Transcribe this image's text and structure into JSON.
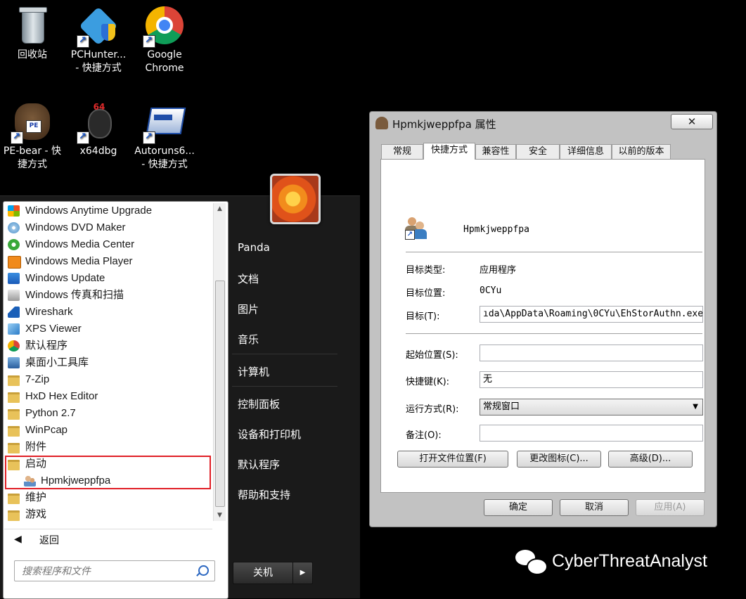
{
  "desktop": {
    "icons": [
      {
        "label": "回收站"
      },
      {
        "label": "PCHunter...",
        "label2": "- 快捷方式"
      },
      {
        "label": "Google",
        "label2": "Chrome"
      },
      {
        "label": "PE-bear - 快",
        "label2": "捷方式",
        "badge": "PE"
      },
      {
        "label": "x64dbg",
        "badge": "64"
      },
      {
        "label": "Autoruns6...",
        "label2": "- 快捷方式"
      }
    ]
  },
  "start_menu": {
    "programs": [
      {
        "label": "Windows Anytime Upgrade",
        "icon": "windows-logo-icon"
      },
      {
        "label": "Windows DVD Maker",
        "icon": "dvd-icon"
      },
      {
        "label": "Windows Media Center",
        "icon": "media-center-icon"
      },
      {
        "label": "Windows Media Player",
        "icon": "media-player-icon"
      },
      {
        "label": "Windows Update",
        "icon": "windows-update-icon"
      },
      {
        "label": "Windows 传真和扫描",
        "icon": "fax-scan-icon"
      },
      {
        "label": "Wireshark",
        "icon": "wireshark-icon"
      },
      {
        "label": "XPS Viewer",
        "icon": "xps-viewer-icon"
      },
      {
        "label": "默认程序",
        "icon": "default-programs-icon"
      },
      {
        "label": "桌面小工具库",
        "icon": "gadgets-icon"
      },
      {
        "label": "7-Zip",
        "icon": "folder-icon"
      },
      {
        "label": "HxD Hex Editor",
        "icon": "folder-icon"
      },
      {
        "label": "Python 2.7",
        "icon": "folder-icon"
      },
      {
        "label": "WinPcap",
        "icon": "folder-icon"
      },
      {
        "label": "附件",
        "icon": "folder-icon"
      },
      {
        "label": "启动",
        "icon": "folder-icon"
      },
      {
        "label": "Hpmkjweppfpa",
        "icon": "users-shortcut-icon"
      },
      {
        "label": "维护",
        "icon": "folder-icon"
      },
      {
        "label": "游戏",
        "icon": "folder-icon"
      }
    ],
    "back_label": "返回",
    "search_placeholder": "搜索程序和文件",
    "right_items": [
      "Panda",
      "文档",
      "图片",
      "音乐",
      "计算机",
      "控制面板",
      "设备和打印机",
      "默认程序",
      "帮助和支持"
    ],
    "shutdown_label": "关机",
    "shutdown_arrow": "▶"
  },
  "dialog": {
    "title": "Hpmkjweppfpa 属性",
    "close_glyph": "✕",
    "tabs": [
      "常规",
      "快捷方式",
      "兼容性",
      "安全",
      "详细信息",
      "以前的版本"
    ],
    "active_tab": "快捷方式",
    "shortcut_name": "Hpmkjweppfpa",
    "target_type_label": "目标类型:",
    "target_type_value": "应用程序",
    "target_location_label": "目标位置:",
    "target_location_value": "0CYu",
    "target_label": "目标(T):",
    "target_value": "ıda\\AppData\\Roaming\\0CYu\\EhStorAuthn.exe",
    "start_in_label": "起始位置(S):",
    "start_in_value": "",
    "hotkey_label": "快捷键(K):",
    "hotkey_value": "无",
    "run_label": "运行方式(R):",
    "run_value": "常规窗口",
    "run_arrow": "▼",
    "comment_label": "备注(O):",
    "comment_value": "",
    "btn_open_location": "打开文件位置(F)",
    "btn_change_icon": "更改图标(C)...",
    "btn_advanced": "高级(D)...",
    "btn_ok": "确定",
    "btn_cancel": "取消",
    "btn_apply": "应用(A)"
  },
  "watermark": {
    "text": "CyberThreatAnalyst"
  }
}
